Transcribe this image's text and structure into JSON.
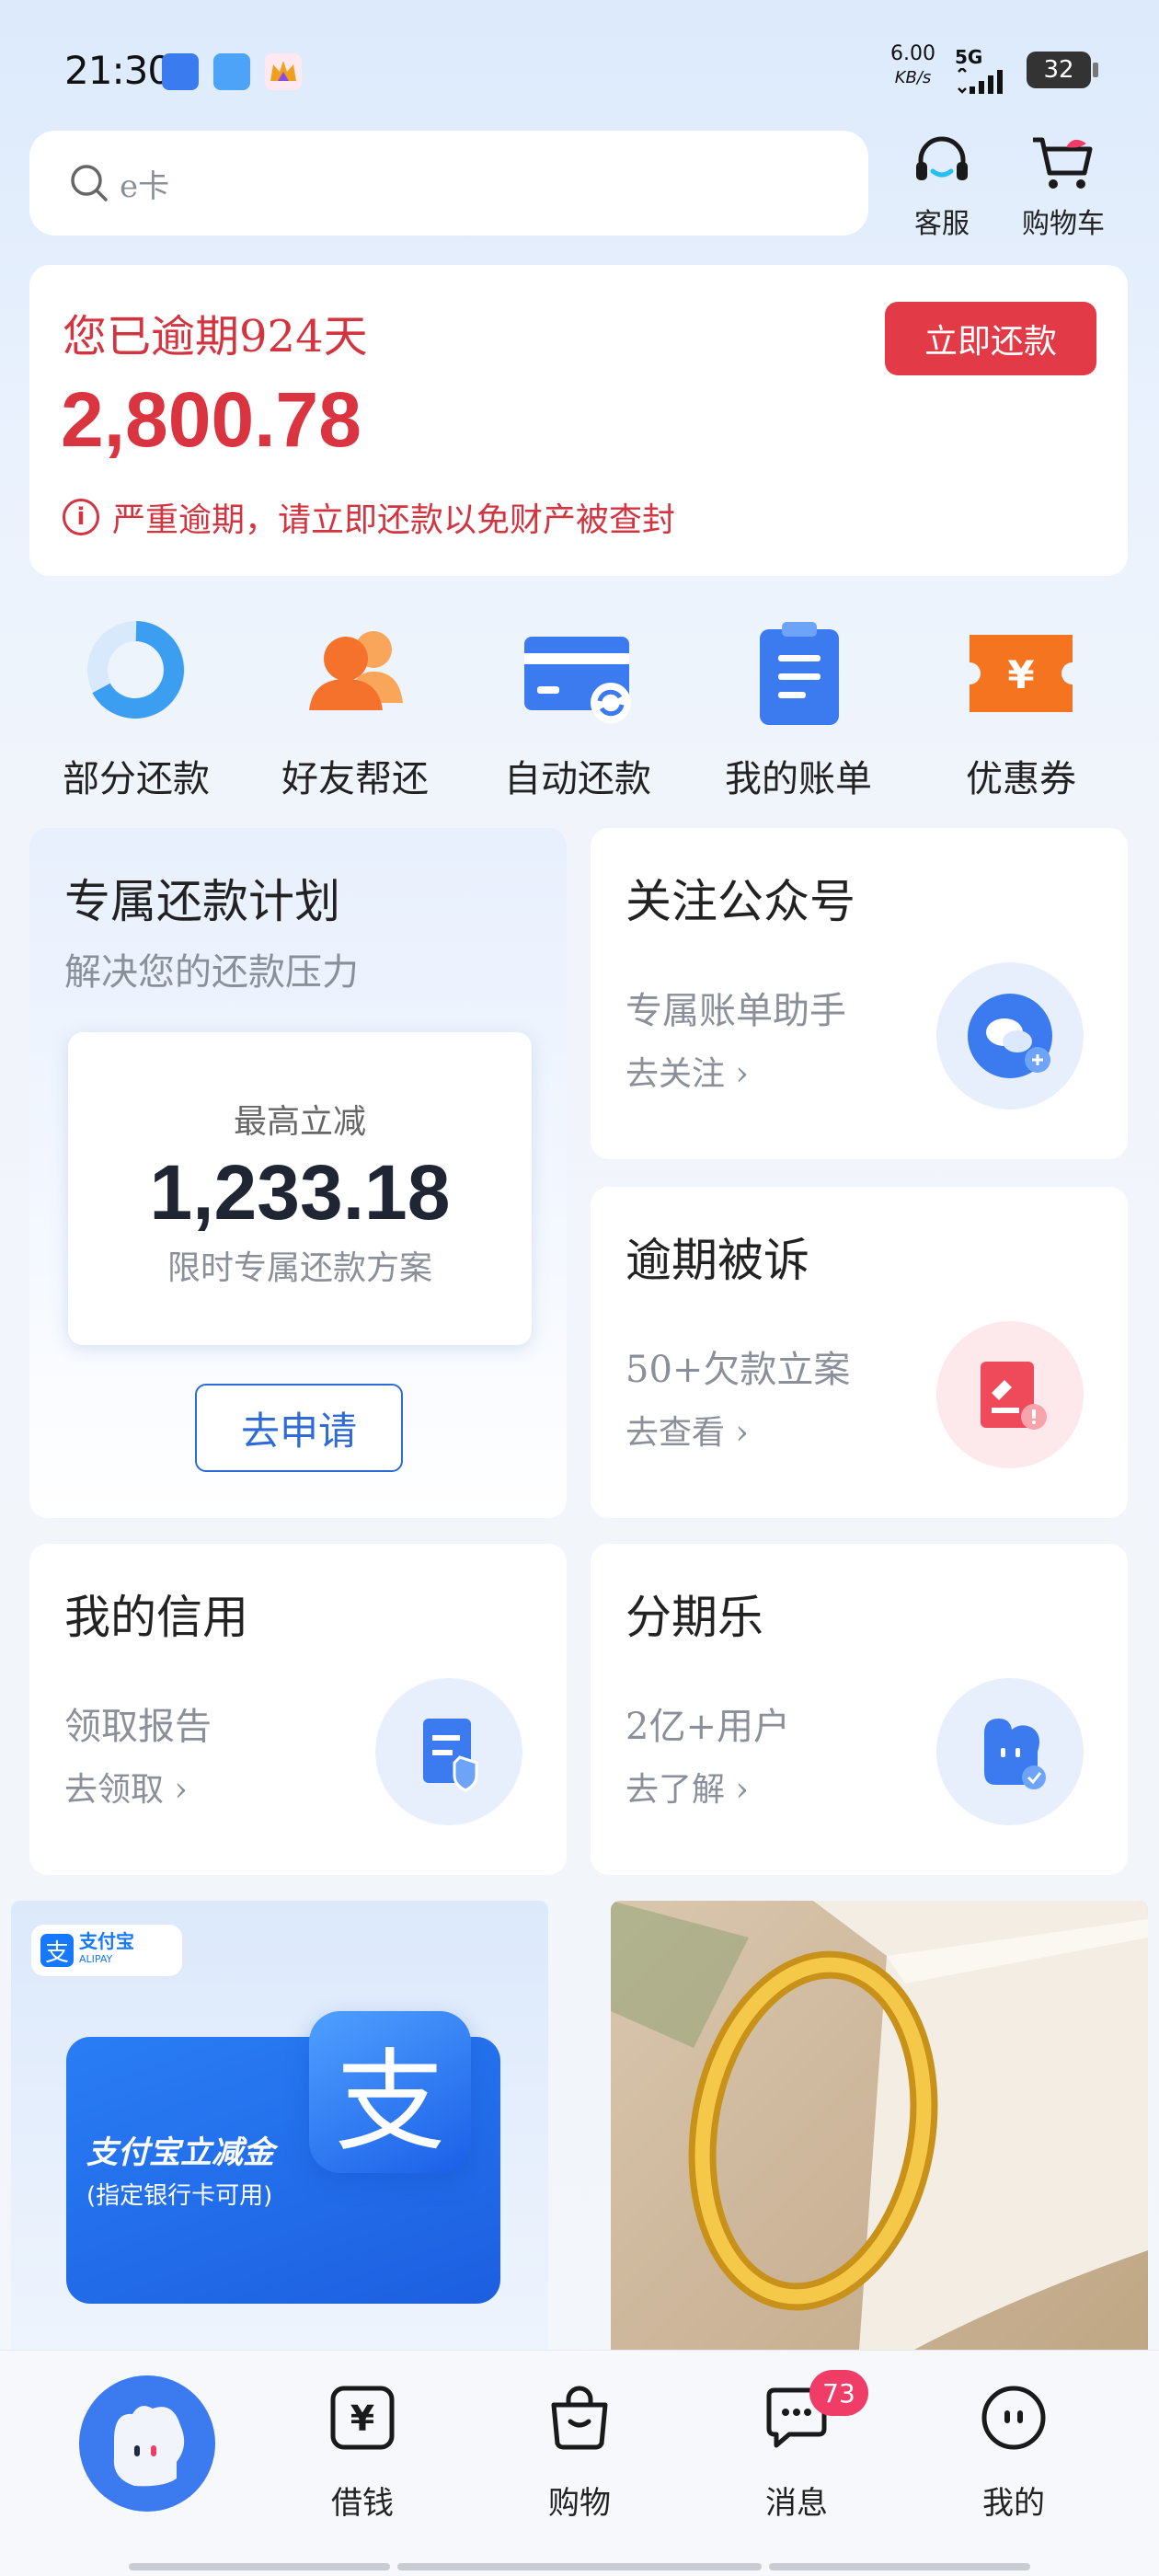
{
  "status_bar": {
    "time": "21:30",
    "net_speed": "6.00",
    "net_unit": "KB/s",
    "network": "5G",
    "battery": "32"
  },
  "search": {
    "placeholder": "e卡"
  },
  "top_actions": [
    {
      "label": "客服",
      "icon": "headset-icon"
    },
    {
      "label": "购物车",
      "icon": "cart-icon"
    }
  ],
  "overdue": {
    "title": "您已逾期924天",
    "amount": "2,800.78",
    "warning": "严重逾期，请立即还款以免财产被查封",
    "repay_button": "立即还款"
  },
  "quick_actions": [
    {
      "label": "部分还款",
      "icon": "partial-repay-icon"
    },
    {
      "label": "好友帮还",
      "icon": "friends-help-icon"
    },
    {
      "label": "自动还款",
      "icon": "auto-repay-card-icon"
    },
    {
      "label": "我的账单",
      "icon": "bill-icon"
    },
    {
      "label": "优惠券",
      "icon": "coupon-icon"
    }
  ],
  "plan": {
    "title": "专属还款计划",
    "subtitle": "解决您的还款压力",
    "label": "最高立减",
    "amount": "1,233.18",
    "desc": "限时专属还款方案",
    "button": "去申请"
  },
  "tiles": {
    "follow": {
      "title": "关注公众号",
      "sub": "专属账单助手",
      "link": "去关注"
    },
    "lawsuit": {
      "title": "逾期被诉",
      "sub": "50+欠款立案",
      "link": "去查看"
    },
    "credit": {
      "title": "我的信用",
      "sub": "领取报告",
      "link": "去领取"
    },
    "installment": {
      "title": "分期乐",
      "sub": "2亿+用户",
      "link": "去了解"
    }
  },
  "banners": {
    "alipay_logo": "支付宝",
    "alipay_logo_en": "ALIPAY",
    "alipay_title": "支付宝立减金",
    "alipay_note": "(指定银行卡可用)",
    "alipay_char": "支"
  },
  "bottom_nav": [
    {
      "label": "借钱",
      "icon": "yuan-icon"
    },
    {
      "label": "购物",
      "icon": "shopping-bag-icon"
    },
    {
      "label": "消息",
      "icon": "message-icon"
    },
    {
      "label": "我的",
      "icon": "profile-icon"
    }
  ],
  "message_badge": "73",
  "colors": {
    "accent_red": "#e23a47",
    "brand_blue": "#2e6bd6",
    "badge_pink": "#ef3d67"
  }
}
